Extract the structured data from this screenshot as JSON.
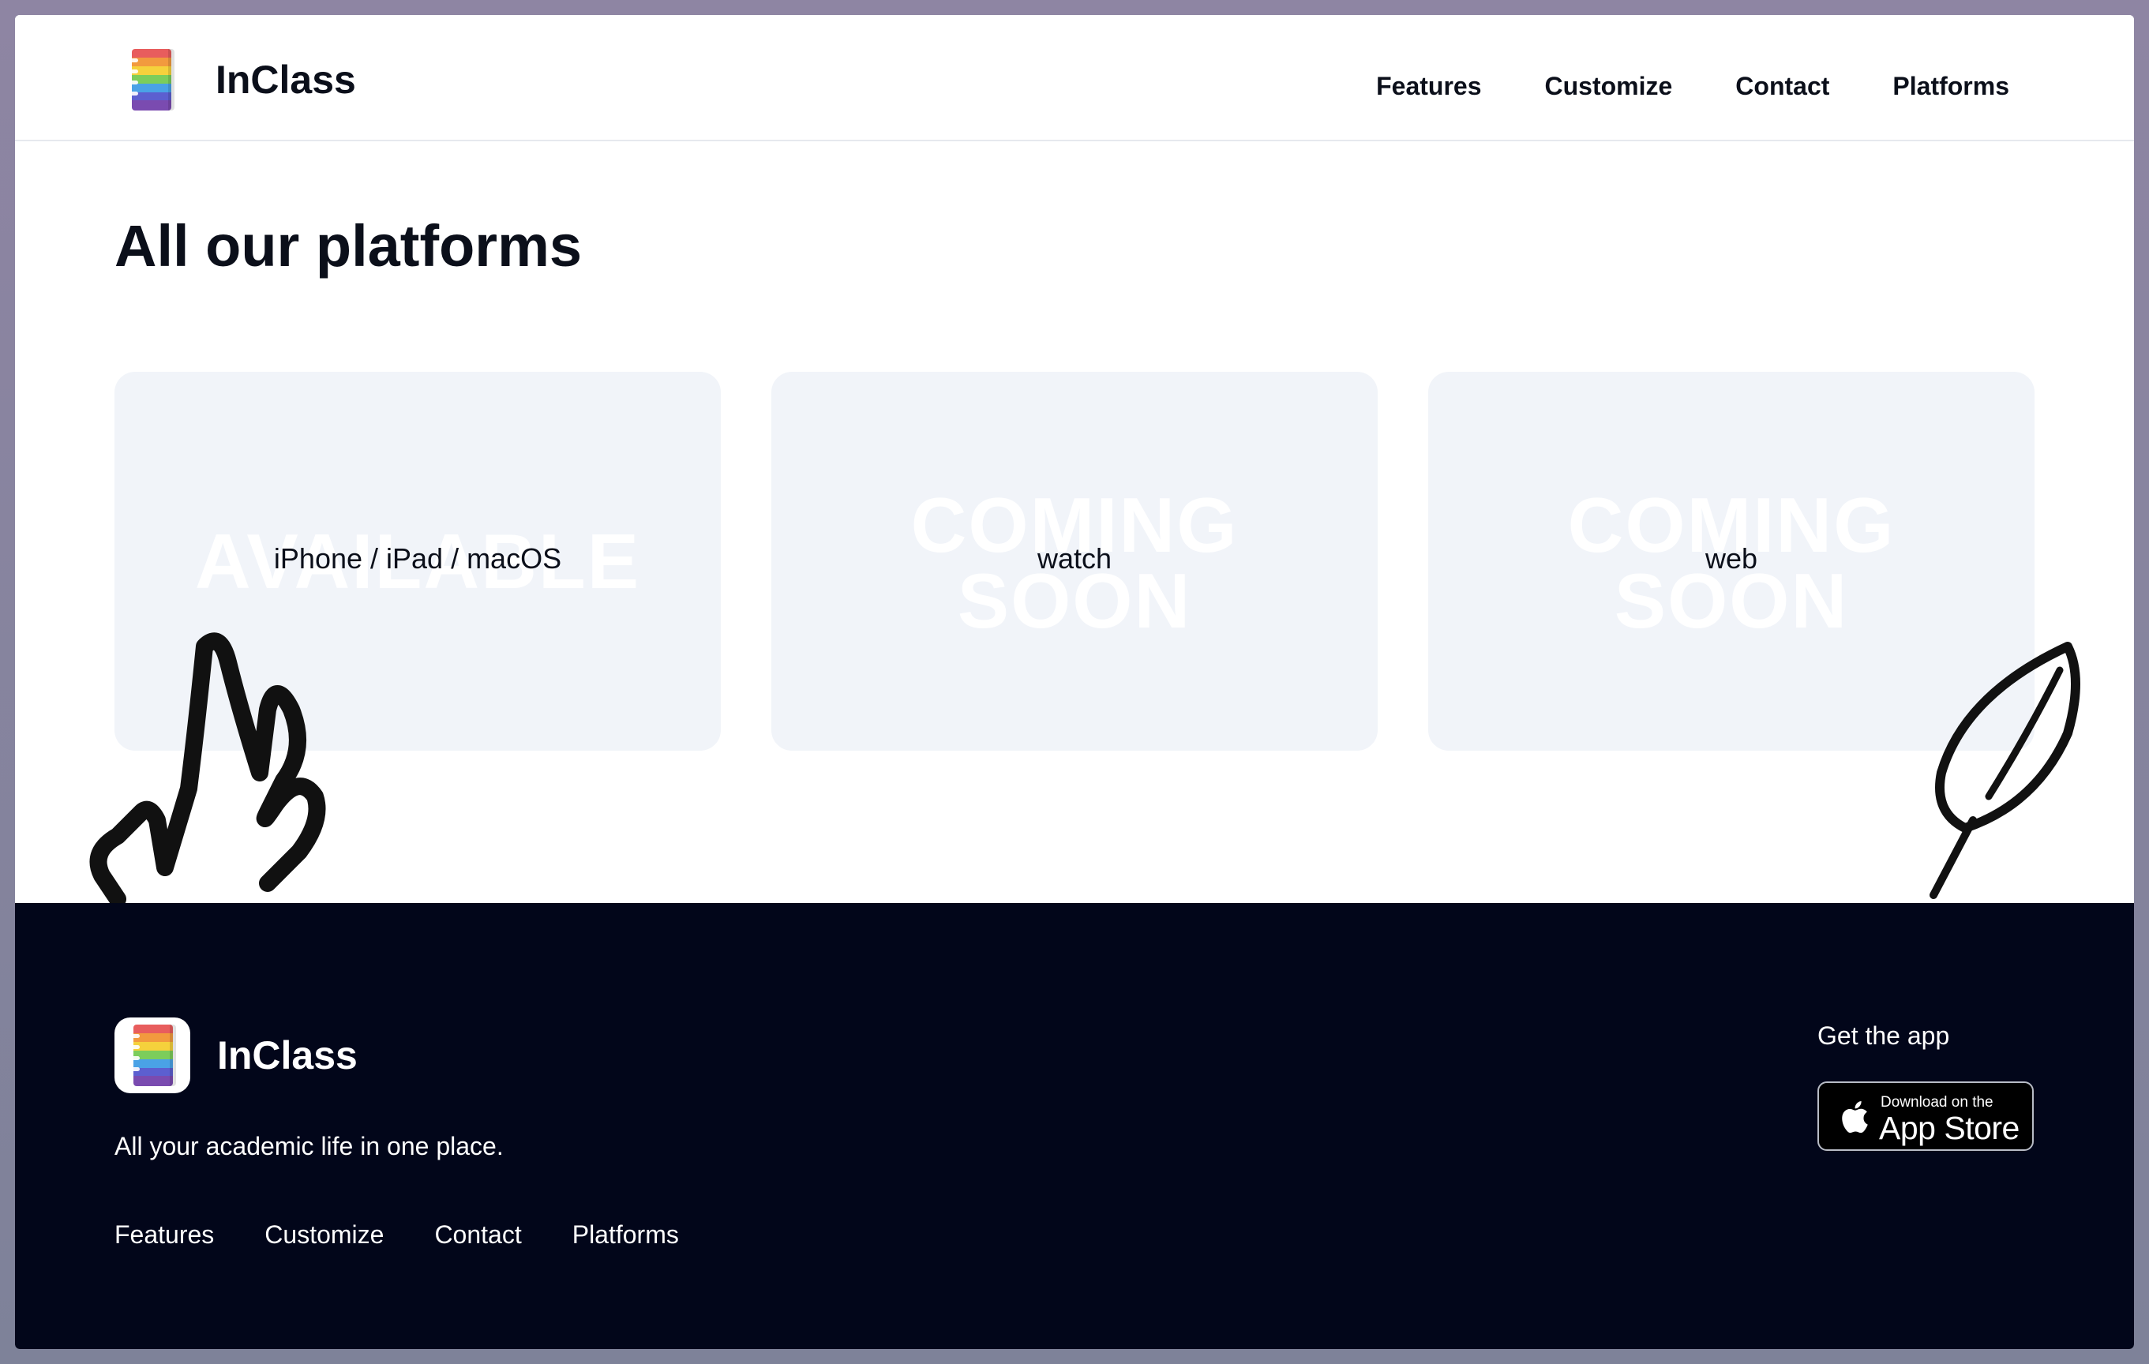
{
  "app": {
    "name": "InClass"
  },
  "brand_colors": [
    "#e85d5d",
    "#f29a3e",
    "#f5d13c",
    "#7ccd5b",
    "#4aa2e6",
    "#5c5fd0",
    "#7a4bb0"
  ],
  "header": {
    "nav": [
      {
        "label": "Features"
      },
      {
        "label": "Customize"
      },
      {
        "label": "Contact"
      },
      {
        "label": "Platforms"
      }
    ]
  },
  "main": {
    "title": "All our platforms",
    "cards": [
      {
        "stamp_line1": "AVAILABLE",
        "stamp_line2": "",
        "label": "iPhone / iPad / macOS"
      },
      {
        "stamp_line1": "COMING",
        "stamp_line2": "SOON",
        "label": "watch"
      },
      {
        "stamp_line1": "COMING",
        "stamp_line2": "SOON",
        "label": "web"
      }
    ]
  },
  "footer": {
    "brand_name": "InClass",
    "tagline": "All your academic life in one place.",
    "nav": [
      {
        "label": "Features"
      },
      {
        "label": "Customize"
      },
      {
        "label": "Contact"
      },
      {
        "label": "Platforms"
      }
    ],
    "get_app": "Get the app",
    "appstore": {
      "small": "Download on the",
      "big": "App Store"
    }
  }
}
